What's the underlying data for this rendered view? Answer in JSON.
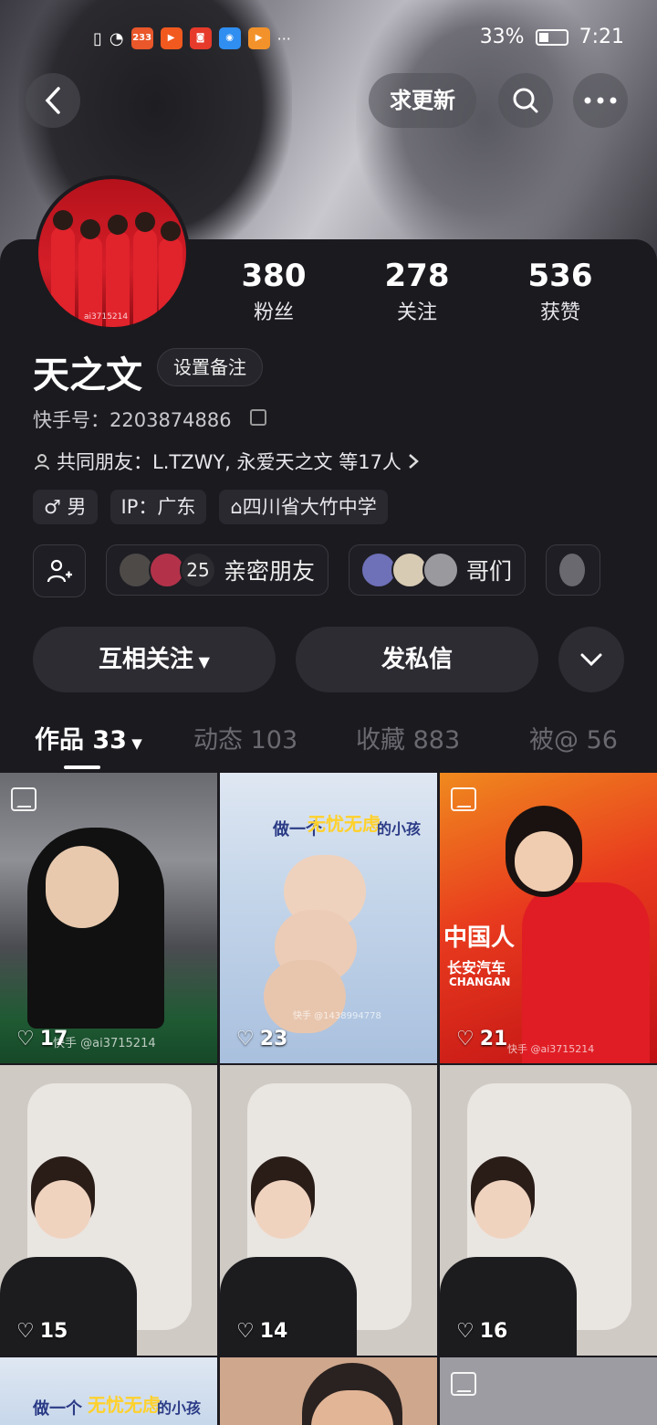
{
  "status_bar": {
    "battery_percent": "33%",
    "time": "7:21",
    "app_badge": "233",
    "dots": "···"
  },
  "top_bar": {
    "update_button": "求更新"
  },
  "profile": {
    "name": "天之文",
    "remark_button": "设置备注",
    "kuaishou_id": "快手号：2203874886",
    "mutual_friends": "共同朋友：L.TZWY, 永爱天之文 等17人",
    "avatar_watermark": "ai3715214"
  },
  "stats": [
    {
      "value": "380",
      "label": "粉丝"
    },
    {
      "value": "278",
      "label": "关注"
    },
    {
      "value": "536",
      "label": "获赞"
    }
  ],
  "tags": {
    "gender": "男",
    "ip": "IP：广东",
    "school": "四川省大竹中学"
  },
  "circles": {
    "close_friends_count": "25",
    "close_friends_label": "亲密朋友",
    "buddies_label": "哥们"
  },
  "actions": {
    "follow_button": "互相关注",
    "message_button": "发私信"
  },
  "tabs": [
    {
      "label": "作品 33"
    },
    {
      "label": "动态 103"
    },
    {
      "label": "收藏 883"
    },
    {
      "label": "被@ 56"
    }
  ],
  "grid": {
    "items": [
      {
        "likes": "17",
        "watermark": "快手 @ai3715214"
      },
      {
        "likes": "23",
        "watermark": "快手 @1438994778",
        "banner_a": "做一个",
        "banner_b": "无忧无虑",
        "banner_c": "的小孩"
      },
      {
        "likes": "21",
        "watermark": "快手 @ai3715214",
        "banner_a": "中国人",
        "banner_b": "长安汽车",
        "banner_c": "CHANGAN"
      },
      {
        "likes": "15"
      },
      {
        "likes": "14"
      },
      {
        "likes": "16"
      },
      {
        "banner_a": "做一个",
        "banner_b": "无忧无虑",
        "banner_c": "的小孩"
      }
    ]
  },
  "colors": {
    "background": "#1b1a1f",
    "pill": "#2d2c33",
    "accent_red": "#d51e28"
  }
}
